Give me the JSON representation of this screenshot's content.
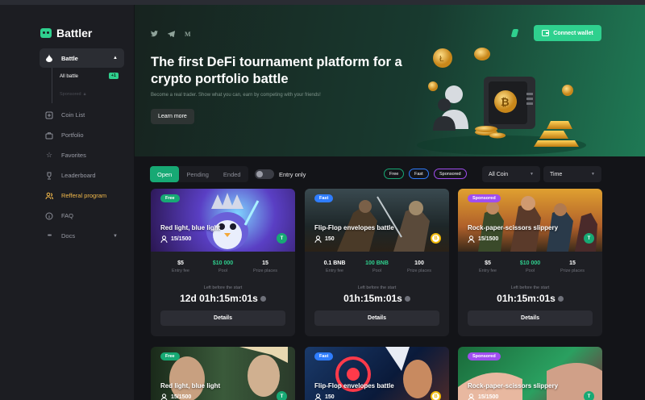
{
  "app": {
    "name": "Battler"
  },
  "sidebar": {
    "items": [
      {
        "label": "Battle",
        "icon": "drop-icon"
      },
      {
        "label": "Coin List",
        "icon": "plus-square-icon"
      },
      {
        "label": "Portfolio",
        "icon": "briefcase-icon"
      },
      {
        "label": "Favorites",
        "icon": "star-icon"
      },
      {
        "label": "Leaderboard",
        "icon": "trophy-icon"
      },
      {
        "label": "Refferal program",
        "icon": "users-icon"
      },
      {
        "label": "FAQ",
        "icon": "info-icon"
      },
      {
        "label": "Docs",
        "icon": "dots-icon"
      }
    ],
    "subitems": [
      {
        "label": "All battle",
        "badge": "+1"
      },
      {
        "label": "Sponsored"
      }
    ],
    "highlight_color": "#f2b94b"
  },
  "hero": {
    "title": "The first DeFi tournament platform for a crypto portfolio battle",
    "subtitle": "Become a real trader. Show what you can, earn by competing with your friends!",
    "learn_more": "Learn more",
    "connect_wallet": "Connect wallet",
    "social": [
      "twitter-icon",
      "telegram-icon",
      "medium-icon"
    ]
  },
  "filters": {
    "tabs": [
      "Open",
      "Pending",
      "Ended"
    ],
    "active_tab": "Open",
    "entry_only": "Entry only",
    "chips": [
      "Free",
      "Fast",
      "Sponsored"
    ],
    "coin_select": "All Coin",
    "time_select": "Time"
  },
  "cards": [
    {
      "badge": "Free",
      "title": "Red light, blue light",
      "players": "15/1500",
      "coin": "T",
      "fee": "$5",
      "pool": "$10 000",
      "prizes": "15",
      "fee_label": "Entry fee",
      "pool_label": "Pool",
      "prize_label": "Prize places",
      "left_label": "Left before the start",
      "timer": "12d 01h:15m:01s",
      "details": "Details"
    },
    {
      "badge": "Fast",
      "title": "Flip-Flop envelopes battle",
      "players": "150",
      "coin": "B",
      "fee": "0.1 BNB",
      "pool": "100 BNB",
      "prizes": "100",
      "fee_label": "Entry fee",
      "pool_label": "Pool",
      "prize_label": "Prize places",
      "left_label": "Left before the start",
      "timer": "01h:15m:01s",
      "details": "Details"
    },
    {
      "badge": "Sponsored",
      "title": "Rock-paper-scissors slippery",
      "players": "15/1500",
      "coin": "T",
      "fee": "$5",
      "pool": "$10 000",
      "prizes": "15",
      "fee_label": "Entry fee",
      "pool_label": "Pool",
      "prize_label": "Prize places",
      "left_label": "Left before the start",
      "timer": "01h:15m:01s",
      "details": "Details"
    },
    {
      "badge": "Free",
      "title": "Red light, blue light",
      "players": "15/1500",
      "coin": "T"
    },
    {
      "badge": "Fast",
      "title": "Flip-Flop envelopes battle",
      "players": "150",
      "coin": "B"
    },
    {
      "badge": "Sponsored",
      "title": "Rock-paper-scissors slippery",
      "players": "15/1500",
      "coin": "T"
    }
  ],
  "colors": {
    "accent": "#2fd08e",
    "fast": "#2f7dff",
    "sponsored": "#a04ef0",
    "free": "#17a974"
  }
}
